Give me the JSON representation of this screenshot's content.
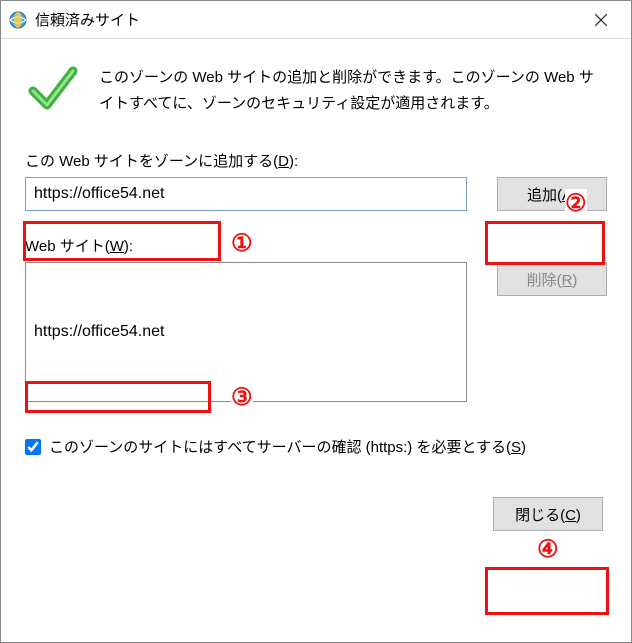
{
  "window": {
    "title": "信頼済みサイト"
  },
  "header": {
    "text": "このゾーンの Web サイトの追加と削除ができます。このゾーンの Web サイトすべてに、ゾーンのセキュリティ設定が適用されます。"
  },
  "add": {
    "label_prefix": "この Web サイトをゾーンに追加する(",
    "label_key": "D",
    "label_suffix": "):",
    "value": "https://office54.net",
    "button_prefix": "追加(",
    "button_key": "A",
    "button_suffix": ")"
  },
  "list": {
    "label_prefix": "Web サイト(",
    "label_key": "W",
    "label_suffix": "):",
    "items": [
      "https://office54.net"
    ],
    "remove_prefix": "削除(",
    "remove_key": "R",
    "remove_suffix": ")"
  },
  "checkbox": {
    "checked": true,
    "label_prefix": "このゾーンのサイトにはすべてサーバーの確認 (https:) を必要とする(",
    "label_key": "S",
    "label_suffix": ")"
  },
  "footer": {
    "close_prefix": "閉じる(",
    "close_key": "C",
    "close_suffix": ")"
  },
  "annotations": {
    "n1": "①",
    "n2": "②",
    "n3": "③",
    "n4": "④"
  }
}
